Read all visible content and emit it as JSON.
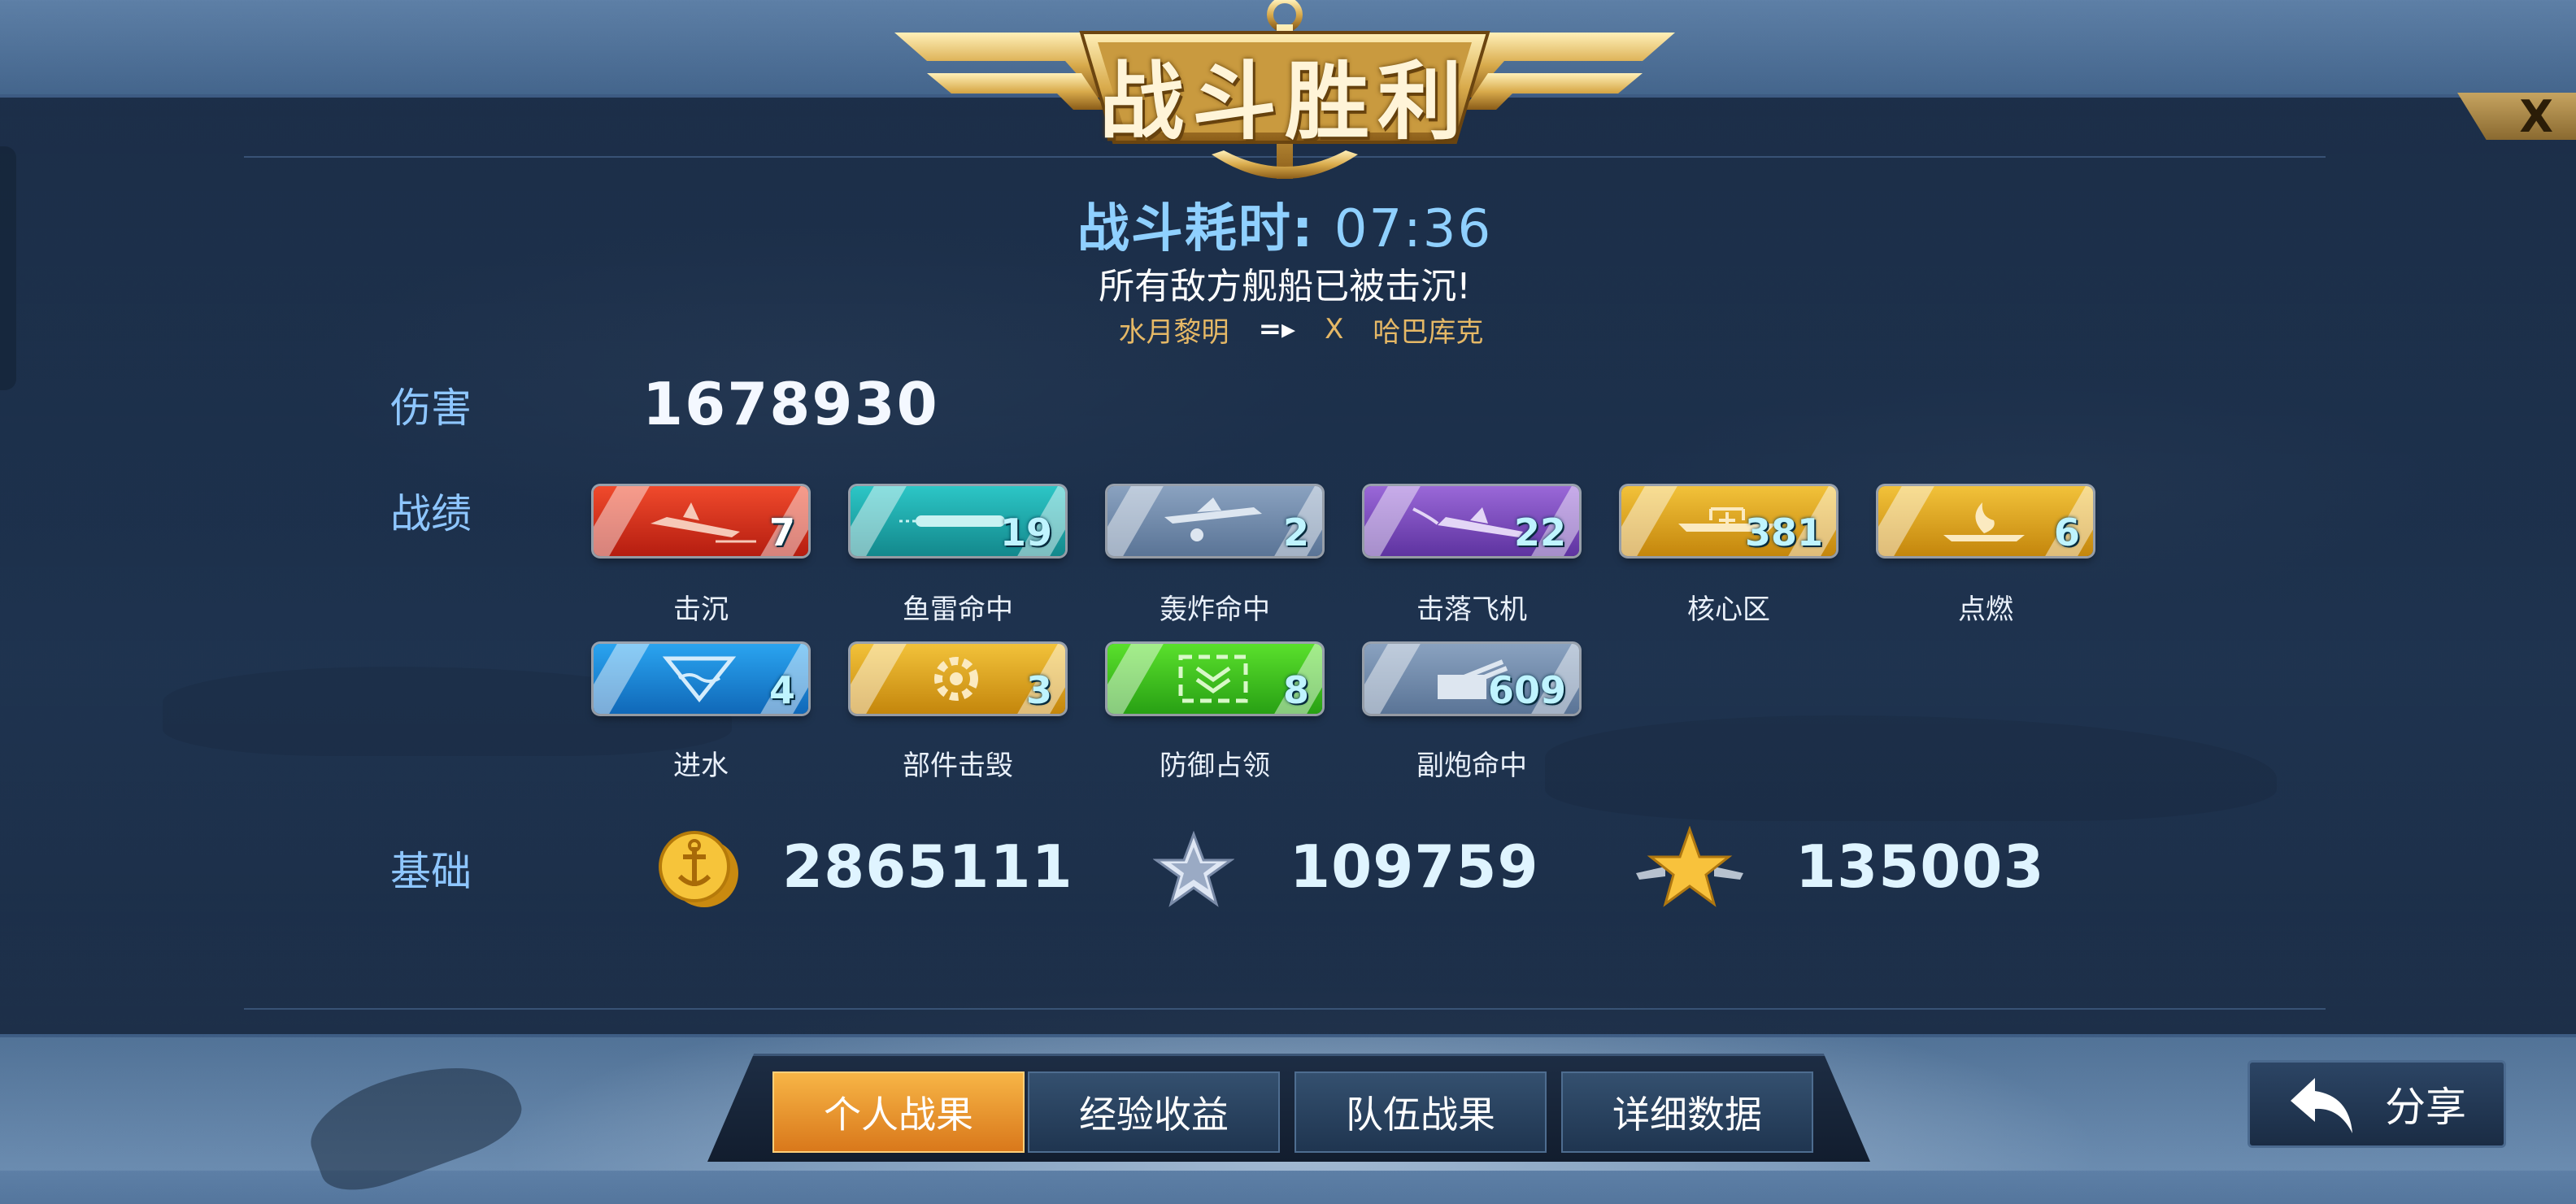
{
  "header": {
    "title": "战斗胜利",
    "close_label": "X"
  },
  "battle": {
    "time_label": "战斗耗时:",
    "time_value": "07:36",
    "result_message": "所有敌方舰船已被击沉!",
    "player_ship": "水月黎明",
    "vs_symbol": "X",
    "enemy_ship": "哈巴库克"
  },
  "damage": {
    "label": "伤害",
    "value": "1678930"
  },
  "record": {
    "label": "战绩",
    "badges": [
      {
        "label": "击沉",
        "value": "7",
        "color": "#d8321e",
        "icon": "sinking-ship-icon"
      },
      {
        "label": "鱼雷命中",
        "value": "19",
        "color": "#1ea8ac",
        "icon": "torpedo-icon"
      },
      {
        "label": "轰炸命中",
        "value": "2",
        "color": "#6f89a8",
        "icon": "bomber-icon"
      },
      {
        "label": "击落飞机",
        "value": "22",
        "color": "#7b4ec0",
        "icon": "plane-shot-down-icon"
      },
      {
        "label": "核心区",
        "value": "381",
        "color": "#e0a018",
        "icon": "core-area-icon"
      },
      {
        "label": "点燃",
        "value": "6",
        "color": "#e0a018",
        "icon": "fire-icon"
      },
      {
        "label": "进水",
        "value": "4",
        "color": "#1e8fd8",
        "icon": "flooding-icon"
      },
      {
        "label": "部件击毁",
        "value": "3",
        "color": "#e0a018",
        "icon": "gear-destroyed-icon"
      },
      {
        "label": "防御占领",
        "value": "8",
        "color": "#3cc81e",
        "icon": "defense-capture-icon"
      },
      {
        "label": "副炮命中",
        "value": "609",
        "color": "#6f89a8",
        "icon": "secondary-gun-icon"
      }
    ]
  },
  "base": {
    "label": "基础",
    "coins": "2865111",
    "silver_star": "109759",
    "gold_star": "135003"
  },
  "tabs": [
    "个人战果",
    "经验收益",
    "队伍战果",
    "详细数据"
  ],
  "share_label": "分享"
}
